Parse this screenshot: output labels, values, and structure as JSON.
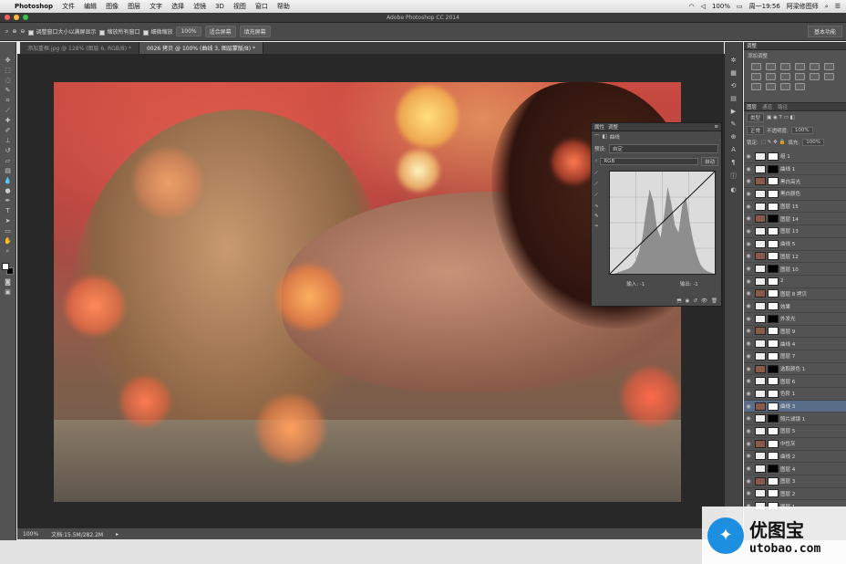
{
  "menubar": {
    "app": "Photoshop",
    "items": [
      "文件",
      "编辑",
      "图像",
      "图层",
      "文字",
      "选择",
      "滤镜",
      "3D",
      "视图",
      "窗口",
      "帮助"
    ],
    "status": {
      "battery": "100%",
      "time": "周一19:56",
      "user": "阿梁修图师"
    }
  },
  "window": {
    "title": "Adobe Photoshop CC 2014"
  },
  "options": {
    "check1": "调整窗口大小以满屏显示",
    "check2": "缩放所有窗口",
    "check3": "细微缩放",
    "zoom": "100%",
    "btn1": "适合屏幕",
    "btn2": "填充屏幕",
    "workspace": "基本功能"
  },
  "tabs": [
    {
      "label": "添加重框.jpg @ 128% (图层 6, RGB/8) *"
    },
    {
      "label": "0026 拷贝 @ 100% (曲线 3, 图层蒙版/8) *"
    }
  ],
  "curves": {
    "tabs": [
      "属性",
      "调整"
    ],
    "title": "曲线",
    "preset_label": "预设:",
    "preset": "自定",
    "channel": "RGB",
    "auto": "自动",
    "input_label": "输入:",
    "input": "-1",
    "output_label": "输出:",
    "output": "-1",
    "histogram": [
      0,
      0,
      1,
      2,
      3,
      4,
      6,
      10,
      18,
      30,
      52,
      70,
      60,
      38,
      30,
      48,
      72,
      58,
      40,
      34,
      56,
      64,
      44,
      28,
      16,
      8,
      4,
      2,
      1,
      0
    ]
  },
  "statusbar": {
    "zoom": "100%",
    "doc": "文档:15.5M/282.2M"
  },
  "adjustments": {
    "tabs": [
      "调整"
    ],
    "subtitle": "添加调整"
  },
  "layers_panel": {
    "tabs": [
      "图层",
      "通道",
      "路径"
    ],
    "kind": "类型",
    "blend": "正常",
    "opacity_label": "不透明度:",
    "opacity": "100%",
    "lock_label": "锁定:",
    "fill_label": "填充:",
    "fill": "100%",
    "items": [
      {
        "name": "组 1",
        "selected": false
      },
      {
        "name": "曲线 1",
        "selected": false
      },
      {
        "name": "黑白高光",
        "selected": false
      },
      {
        "name": "黑白颜色",
        "selected": false
      },
      {
        "name": "图层 15",
        "selected": false
      },
      {
        "name": "图层 14",
        "selected": false
      },
      {
        "name": "图层 13",
        "selected": false
      },
      {
        "name": "曲线 5",
        "selected": false
      },
      {
        "name": "图层 12",
        "selected": false
      },
      {
        "name": "图层 10",
        "selected": false
      },
      {
        "name": "2",
        "selected": false
      },
      {
        "name": "图层 8 拷贝",
        "selected": false
      },
      {
        "name": "效果",
        "selected": false
      },
      {
        "name": "外发光",
        "selected": false
      },
      {
        "name": "图层 9",
        "selected": false
      },
      {
        "name": "曲线 4",
        "selected": false
      },
      {
        "name": "图层 7",
        "selected": false
      },
      {
        "name": "选取颜色 1",
        "selected": false
      },
      {
        "name": "图层 6",
        "selected": false
      },
      {
        "name": "色阶 1",
        "selected": false
      },
      {
        "name": "曲线 3",
        "selected": true
      },
      {
        "name": "照片滤镜 1",
        "selected": false
      },
      {
        "name": "图层 5",
        "selected": false
      },
      {
        "name": "中性灰",
        "selected": false
      },
      {
        "name": "曲线 2",
        "selected": false
      },
      {
        "name": "图层 4",
        "selected": false
      },
      {
        "name": "图层 3",
        "selected": false
      },
      {
        "name": "图层 2",
        "selected": false
      },
      {
        "name": "图层 1",
        "selected": false
      }
    ]
  },
  "watermark": {
    "logo_cn": "优图宝",
    "logo_en": "utobao.com"
  },
  "colors": {
    "accent": "#5a6d88",
    "panel": "#535353",
    "dark": "#282828"
  }
}
